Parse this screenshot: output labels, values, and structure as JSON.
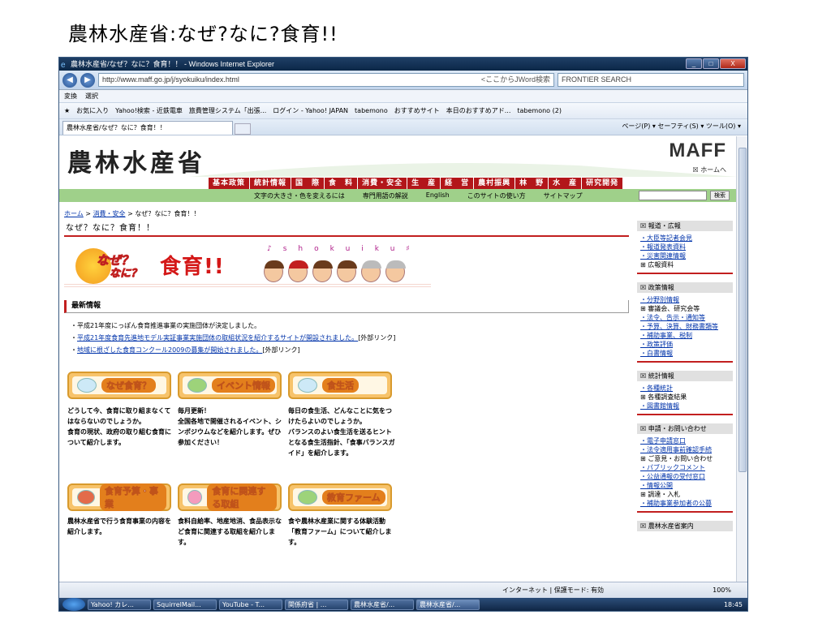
{
  "slide": {
    "title": "農林水産省:なぜ?なに?食育!!"
  },
  "window": {
    "title": "農林水産省/なぜ？なに？食育！！ - Windows Internet Explorer",
    "min": "_",
    "max": "□",
    "close": "X"
  },
  "address": {
    "url": "http://www.maff.go.jp/j/syokuiku/index.html",
    "jword_hint": "<ここからJWord検索",
    "search_placeholder": "FRONTIER SEARCH"
  },
  "toolbar": {
    "convert": "変換",
    "select": "選択"
  },
  "favorites": {
    "label": "お気に入り",
    "items": [
      "Yahoo!検索 - 近鉄電車",
      "旅費管理システム「出張...",
      "ログイン - Yahoo! JAPAN",
      "tabemono",
      "おすすめサイト",
      "本日のおすすめアド...",
      "tabemono (2)"
    ]
  },
  "tab": {
    "label": "農林水産省/なぜ？なに？食育！！"
  },
  "commandbar": "ページ(P) ▾ セーフティ(S) ▾ ツール(O) ▾",
  "site": {
    "logo_jp": "農林水産省",
    "logo_en": "MAFF",
    "home_link": "☒ ホームへ",
    "menu": [
      "基本政策",
      "統計情報",
      "国　際",
      "食　料",
      "消費・安全",
      "生　産",
      "経　営",
      "農村振興",
      "林　野",
      "水　産",
      "研究開発"
    ],
    "sub_links": [
      "文字の大きさ・色を変えるには",
      "専門用語の解説",
      "English",
      "このサイトの使い方",
      "サイトマップ"
    ],
    "search_button": "検索"
  },
  "breadcrumb": {
    "home": "ホーム",
    "sep1": " > ",
    "cat": "消費・安全",
    "sep2": " > ",
    "current": "なぜ？なに？食育！！"
  },
  "page": {
    "heading": "なぜ？なに？食育！！",
    "banner": {
      "line1": "なぜ？",
      "line2": "なに？",
      "big": "食育!!",
      "shokuiku": "♪shokuiku♯"
    }
  },
  "news": {
    "heading": "最新情報",
    "items": [
      {
        "text": "平成21年度にっぽん食育推進事業の実施団体が決定しました。",
        "suffix": ""
      },
      {
        "text": "平成21年度食育先進地モデル実証事業実施団体の取組状況を紹介するサイトが開設されました。",
        "suffix": "[外部リンク]"
      },
      {
        "text": "地域に根ざした食育コンクール2009の募集が開始されました。",
        "suffix": "[外部リンク]"
      }
    ]
  },
  "cards": [
    {
      "label": "なぜ食育？",
      "bold": "どうして今、食育に取り組まなくてはならないのでしょうか。",
      "normal": "食育の現状、政府の取り組む食育について紹介します。"
    },
    {
      "label": "イベント情報",
      "bold": "毎月更新！",
      "normal": "全国各地で開催されるイベント、シンポジウムなどを紹介します。ぜひ参加ください！"
    },
    {
      "label": "食生活",
      "bold": "毎日の食生活、どんなことに気をつけたらよいのでしょうか。",
      "normal": "バランスのよい食生活を送るヒントとなる食生活指針、「食事バランスガイド」を紹介します。"
    },
    {
      "label": "食育予算・事業",
      "bold": "農林水産省で行う食育事業の内容を紹介します。",
      "normal": ""
    },
    {
      "label": "食育に関連する取組",
      "bold": "食料自給率、地産地消、食品表示など食育に関連する取組を紹介します。",
      "normal": ""
    },
    {
      "label": "教育ファーム",
      "bold": "食や農林水産業に関する体験活動「教育ファーム」について紹介します。",
      "normal": ""
    }
  ],
  "sidebar": [
    {
      "head": "報道・広報",
      "items": [
        {
          "t": "大臣等記者会見",
          "k": "link"
        },
        {
          "t": "報道発表資料",
          "k": "link"
        },
        {
          "t": "災害関連情報",
          "k": "link"
        },
        {
          "t": "広報資料",
          "k": "plus"
        }
      ]
    },
    {
      "head": "政策情報",
      "items": [
        {
          "t": "分野別情報",
          "k": "link"
        },
        {
          "t": "審議会、研究会等",
          "k": "plus"
        },
        {
          "t": "法令、告示・通知等",
          "k": "link"
        },
        {
          "t": "予算、決算、財務書類等",
          "k": "link"
        },
        {
          "t": "補助事業、税制",
          "k": "link"
        },
        {
          "t": "政策評価",
          "k": "link"
        },
        {
          "t": "白書情報",
          "k": "link"
        }
      ]
    },
    {
      "head": "統計情報",
      "items": [
        {
          "t": "各種統計",
          "k": "link"
        },
        {
          "t": "各種調査結果",
          "k": "plus"
        },
        {
          "t": "図書館情報",
          "k": "link"
        }
      ]
    },
    {
      "head": "申請・お問い合わせ",
      "items": [
        {
          "t": "電子申請窓口",
          "k": "link"
        },
        {
          "t": "法令適用事前確認手続",
          "k": "link"
        },
        {
          "t": "ご意見・お問い合わせ",
          "k": "plus"
        },
        {
          "t": "パブリックコメント",
          "k": "link"
        },
        {
          "t": "公益通報の受付窓口",
          "k": "link"
        },
        {
          "t": "情報公開",
          "k": "link"
        },
        {
          "t": "調達・入札",
          "k": "plus"
        },
        {
          "t": "補助事業参加者の公募",
          "k": "link"
        }
      ]
    },
    {
      "head": "農林水産省案内",
      "items": []
    }
  ],
  "status": {
    "zone": "インターネット | 保護モード: 有効",
    "zoom": "100%"
  },
  "taskbar": {
    "tasks": [
      "Yahoo! カレ...",
      "SquirrelMail...",
      "YouTube - T...",
      "関係府省 | ...",
      "農林水産省/...",
      "農林水産省/..."
    ],
    "clock": "18:45"
  }
}
